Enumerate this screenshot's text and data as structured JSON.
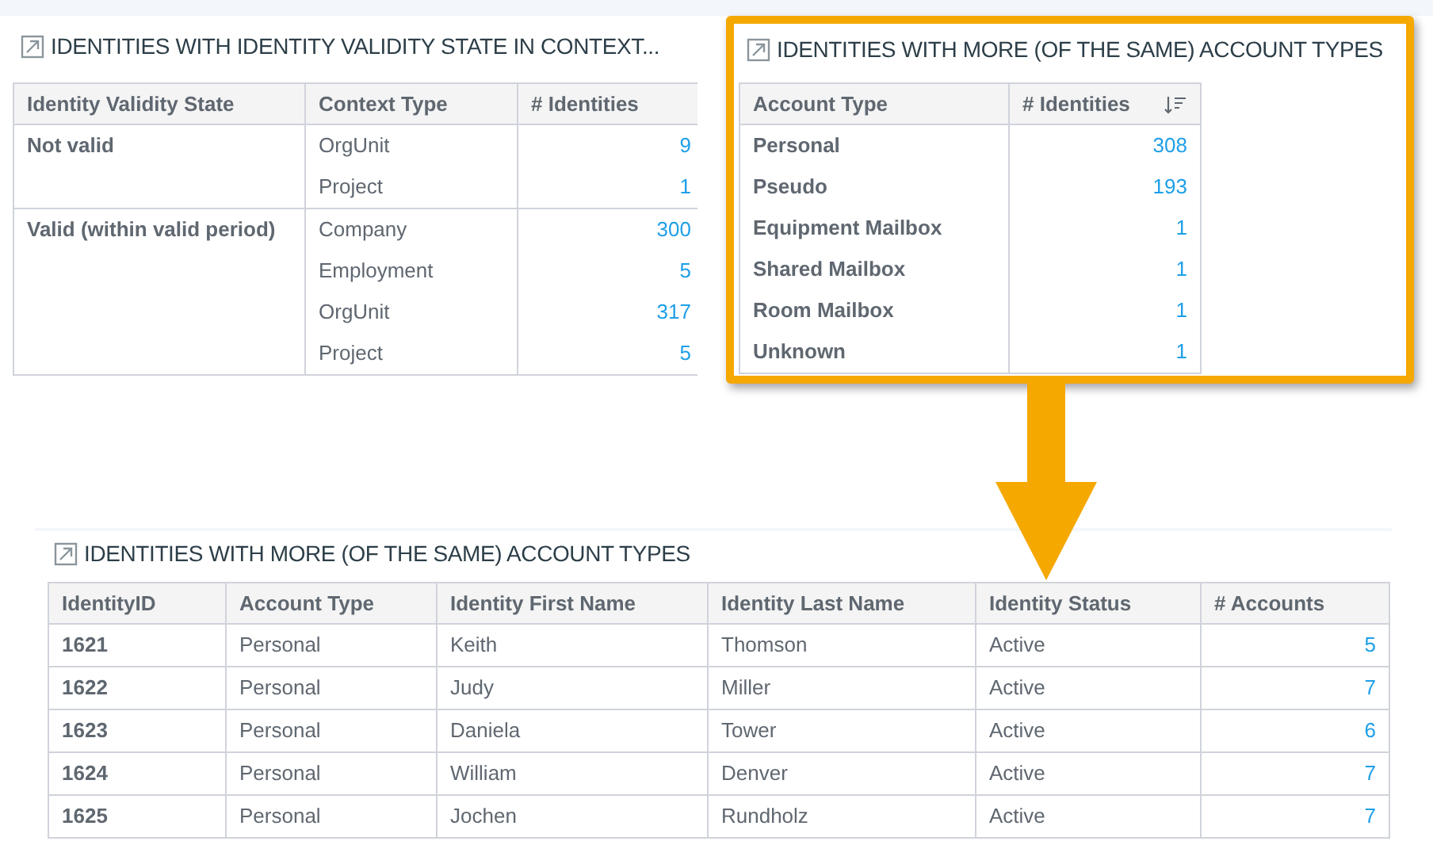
{
  "validity_panel": {
    "title": "IDENTITIES WITH IDENTITY VALIDITY STATE IN CONTEXT...",
    "columns": [
      "Identity Validity State",
      "Context Type",
      "# Identities"
    ],
    "groups": [
      {
        "state": "Not valid",
        "rows": [
          {
            "context_type": "OrgUnit",
            "count": "9"
          },
          {
            "context_type": "Project",
            "count": "1"
          }
        ]
      },
      {
        "state": "Valid (within valid period)",
        "rows": [
          {
            "context_type": "Company",
            "count": "300"
          },
          {
            "context_type": "Employment",
            "count": "5"
          },
          {
            "context_type": "OrgUnit",
            "count": "317"
          },
          {
            "context_type": "Project",
            "count": "5"
          }
        ]
      }
    ]
  },
  "account_types_panel": {
    "title": "IDENTITIES WITH MORE (OF THE SAME) ACCOUNT TYPES",
    "highlighted": true,
    "columns": [
      {
        "label": "Account Type",
        "sorted": false
      },
      {
        "label": "# Identities",
        "sorted": true
      }
    ],
    "rows": [
      [
        "Personal",
        "308"
      ],
      [
        "Pseudo",
        "193"
      ],
      [
        "Equipment Mailbox",
        "1"
      ],
      [
        "Shared Mailbox",
        "1"
      ],
      [
        "Room Mailbox",
        "1"
      ],
      [
        "Unknown",
        "1"
      ]
    ]
  },
  "detail_panel": {
    "title": "IDENTITIES WITH MORE (OF THE SAME) ACCOUNT TYPES",
    "columns": [
      "IdentityID",
      "Account Type",
      "Identity First Name",
      "Identity Last Name",
      "Identity Status",
      "# Accounts"
    ],
    "rows": [
      [
        "1621",
        "Personal",
        "Keith",
        "Thomson",
        "Active",
        "5"
      ],
      [
        "1622",
        "Personal",
        "Judy",
        "Miller",
        "Active",
        "7"
      ],
      [
        "1623",
        "Personal",
        "Daniela",
        "Tower",
        "Active",
        "6"
      ],
      [
        "1624",
        "Personal",
        "William",
        "Denver",
        "Active",
        "7"
      ],
      [
        "1625",
        "Personal",
        "Jochen",
        "Rundholz",
        "Active",
        "7"
      ]
    ]
  }
}
